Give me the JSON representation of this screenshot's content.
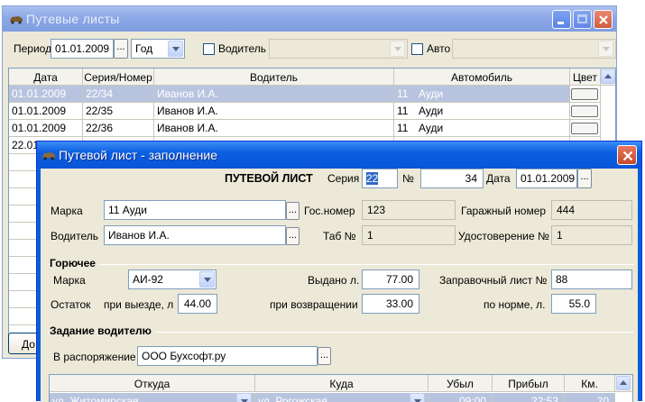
{
  "back_window": {
    "title": "Путевые листы",
    "period_label": "Период",
    "period_date": "01.01.2009",
    "ellipsis": "...",
    "period_unit": "Год",
    "driver_label": "Водитель",
    "auto_label": "Авто",
    "columns": [
      "Дата",
      "Серия/Номер",
      "Водитель",
      "Автомобиль",
      "Цвет"
    ],
    "rows": [
      {
        "date": "01.01.2009",
        "series": "22/34",
        "driver": "Иванов И.А.",
        "car_no": "11",
        "car": "Ауди",
        "selected": true
      },
      {
        "date": "01.01.2009",
        "series": "22/35",
        "driver": "Иванов И.А.",
        "car_no": "11",
        "car": "Ауди",
        "selected": false
      },
      {
        "date": "01.01.2009",
        "series": "22/36",
        "driver": "Иванов И.А.",
        "car_no": "11",
        "car": "Ауди",
        "selected": false
      },
      {
        "date": "22.01",
        "series": "",
        "driver": "",
        "car_no": "",
        "car": "",
        "selected": false
      }
    ],
    "bottom_button_fragment": "До"
  },
  "dialog": {
    "title": "Путевой лист - заполнение",
    "header": {
      "doc_title": "ПУТЕВОЙ ЛИСТ",
      "series_label": "Серия",
      "series_value": "22",
      "number_label": "№",
      "number_value": "34",
      "date_label": "Дата",
      "date_value": "01.01.2009"
    },
    "vehicle": {
      "brand_label": "Марка",
      "brand_value": "11   Ауди",
      "gos_label": "Гос.номер",
      "gos_value": "123",
      "garage_label": "Гаражный номер",
      "garage_value": "444",
      "driver_label": "Водитель",
      "driver_value": "Иванов И.А.",
      "tab_label": "Таб №",
      "tab_value": "1",
      "license_label": "Удостоверение №",
      "license_value": "1"
    },
    "fuel": {
      "section_title": "Горючее",
      "brand_label": "Марка",
      "brand_value": "АИ-92",
      "issued_label": "Выдано л.",
      "issued_value": "77.00",
      "refuel_label": "Заправочный лист №",
      "refuel_value": "88",
      "remain_label": "Остаток",
      "depart_label": "при выезде, л",
      "depart_value": "44.00",
      "return_label": "при возвращении",
      "return_value": "33.00",
      "norm_label": "по норме, л.",
      "norm_value": "55.0"
    },
    "task": {
      "section_title": "Задание водителю",
      "dispose_label": "В распоряжение",
      "dispose_value": "ООО Бухсофт.ру",
      "columns": [
        "Откуда",
        "Куда",
        "Убыл",
        "Прибыл",
        "Км."
      ],
      "first_row": {
        "from": "ул. Житомирская",
        "to": "ул. Рогожская",
        "left": "09:00",
        "arrived": "22:53",
        "km": "20"
      }
    }
  }
}
